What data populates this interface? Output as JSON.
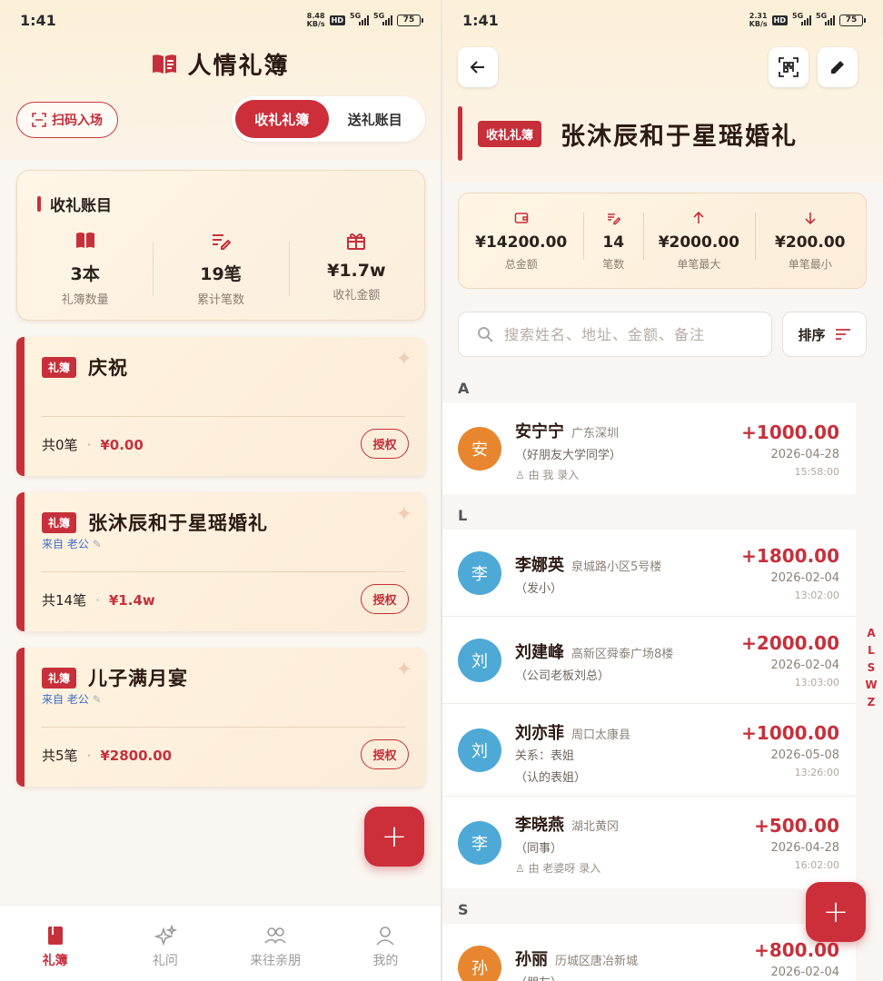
{
  "left": {
    "status": {
      "time": "1:41",
      "speed_top": "8.48",
      "speed_unit": "KB/s",
      "hd": "HD",
      "net1": "5G",
      "net2": "5G",
      "battery": "75"
    },
    "title": "人情礼簿",
    "scan_label": "扫码入场",
    "segments": [
      "收礼礼簿",
      "送礼账目"
    ],
    "summary": {
      "title": "收礼账目",
      "stats": [
        {
          "value": "3本",
          "label": "礼簿数量",
          "icon": "book-icon"
        },
        {
          "value": "19笔",
          "label": "累计笔数",
          "icon": "edit-list-icon"
        },
        {
          "value": "¥1.7w",
          "label": "收礼金额",
          "icon": "gift-icon"
        }
      ]
    },
    "books": [
      {
        "tag": "礼簿",
        "name": "庆祝",
        "from": "",
        "count": "共0笔",
        "amount": "¥0.00",
        "auth": "授权"
      },
      {
        "tag": "礼簿",
        "name": "张沐辰和于星瑶婚礼",
        "from": "来自 老公",
        "count": "共14笔",
        "amount": "¥1.4w",
        "auth": "授权"
      },
      {
        "tag": "礼簿",
        "name": "儿子满月宴",
        "from": "来自 老公",
        "count": "共5笔",
        "amount": "¥2800.00",
        "auth": "授权"
      }
    ],
    "nav": [
      {
        "label": "礼簿",
        "icon": "book-filled-icon"
      },
      {
        "label": "礼问",
        "icon": "sparkle-icon"
      },
      {
        "label": "来往亲朋",
        "icon": "people-icon"
      },
      {
        "label": "我的",
        "icon": "person-icon"
      }
    ]
  },
  "right": {
    "status": {
      "time": "1:41",
      "speed_top": "2.31",
      "speed_unit": "KB/s",
      "hd": "HD",
      "net1": "5G",
      "net2": "5G",
      "battery": "75"
    },
    "tag": "收礼礼簿",
    "title": "张沐辰和于星瑶婚礼",
    "stats": [
      {
        "value": "¥14200.00",
        "label": "总金额",
        "icon": "wallet-icon"
      },
      {
        "value": "14",
        "label": "笔数",
        "icon": "edit-list-icon"
      },
      {
        "value": "¥2000.00",
        "label": "单笔最大",
        "icon": "arrow-up-icon"
      },
      {
        "value": "¥200.00",
        "label": "单笔最小",
        "icon": "arrow-down-icon"
      }
    ],
    "search_placeholder": "搜索姓名、地址、金额、备注",
    "sort_label": "排序",
    "groups": [
      {
        "letter": "A",
        "entries": [
          {
            "avatar": "安",
            "name": "安宁宁",
            "addr": "广东深圳",
            "lines": [
              "（好朋友大学同学）"
            ],
            "recorder": "由 我 录入",
            "amount": "+1000.00",
            "date": "2026-04-28",
            "time": "15:58:00",
            "color": "#e8862f"
          }
        ]
      },
      {
        "letter": "L",
        "entries": [
          {
            "avatar": "李",
            "name": "李娜英",
            "addr": "泉城路小区5号楼",
            "lines": [
              "（发小）"
            ],
            "recorder": "",
            "amount": "+1800.00",
            "date": "2026-02-04",
            "time": "13:02:00",
            "color": "#4fa9d6"
          },
          {
            "avatar": "刘",
            "name": "刘建峰",
            "addr": "高新区舜泰广场8楼",
            "lines": [
              "（公司老板刘总）"
            ],
            "recorder": "",
            "amount": "+2000.00",
            "date": "2026-02-04",
            "time": "13:03:00",
            "color": "#4fa9d6"
          },
          {
            "avatar": "刘",
            "name": "刘亦菲",
            "addr": "周口太康县",
            "lines": [
              "关系：表姐",
              "（认的表姐）"
            ],
            "recorder": "",
            "amount": "+1000.00",
            "date": "2026-05-08",
            "time": "13:26:00",
            "color": "#4fa9d6"
          },
          {
            "avatar": "李",
            "name": "李晓燕",
            "addr": "湖北黄冈",
            "lines": [
              "（同事）"
            ],
            "recorder": "由 老婆呀 录入",
            "amount": "+500.00",
            "date": "2026-04-28",
            "time": "16:02:00",
            "color": "#4fa9d6"
          }
        ]
      },
      {
        "letter": "S",
        "entries": [
          {
            "avatar": "孙",
            "name": "孙丽",
            "addr": "历城区唐冶新城",
            "lines": [
              "（朋友）"
            ],
            "recorder": "",
            "amount": "+800.00",
            "date": "2026-02-04",
            "time": "",
            "color": "#e8862f"
          }
        ]
      }
    ],
    "alpha_index": [
      "A",
      "L",
      "S",
      "W",
      "Z"
    ]
  },
  "colors": {
    "brand": "#cc2f3a",
    "avatar_orange": "#e8862f",
    "avatar_blue": "#4fa9d6"
  }
}
